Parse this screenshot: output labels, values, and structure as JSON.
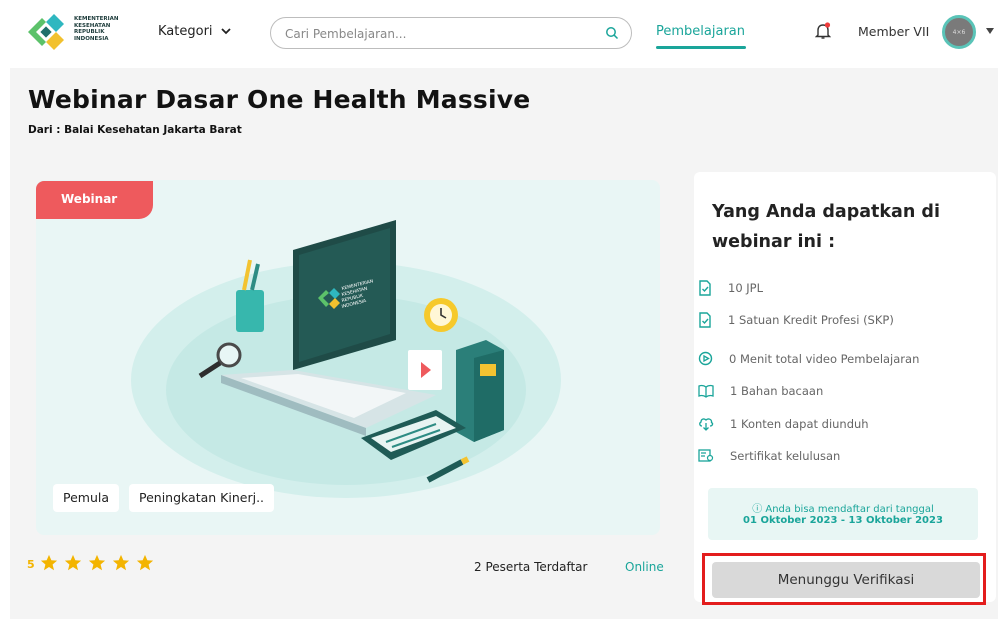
{
  "header": {
    "logo_text": [
      "KEMENTERIAN",
      "KESEHATAN",
      "REPUBLIK",
      "INDONESIA"
    ],
    "kategori_label": "Kategori",
    "search_placeholder": "Cari Pembelajaran...",
    "nav_active": "Pembelajaran",
    "member_name": "Member VII"
  },
  "page": {
    "title": "Webinar Dasar One Health Massive",
    "subtitle": "Dari : Balai Kesehatan Jakarta Barat"
  },
  "banner": {
    "tag": "Webinar",
    "chips": [
      "Pemula",
      "Peningkatan Kinerj.."
    ],
    "laptop_screen_text": [
      "KEMENTERIAN",
      "KESEHATAN",
      "REPUBLIK",
      "INDONESIA"
    ]
  },
  "stats": {
    "rating": "5",
    "stars": 5,
    "participants": "2 Peserta Terdaftar",
    "mode": "Online"
  },
  "sidebar": {
    "title": "Yang Anda dapatkan di webinar ini :",
    "features": [
      {
        "icon": "document-check-icon",
        "text": "10 JPL"
      },
      {
        "icon": "document-check-icon",
        "text": "1 Satuan Kredit Profesi (SKP)"
      },
      {
        "icon": "play-circle-icon",
        "text": "0 Menit total video Pembelajaran"
      },
      {
        "icon": "book-open-icon",
        "text": "1 Bahan bacaan"
      },
      {
        "icon": "cloud-download-icon",
        "text": "1 Konten dapat diunduh"
      },
      {
        "icon": "certificate-icon",
        "text": "Sertifikat kelulusan"
      }
    ],
    "notice_line1": "ⓘ Anda bisa mendaftar dari tanggal",
    "notice_line2": "01 Oktober 2023 - 13 Oktober 2023",
    "button_label": "Menunggu Verifikasi"
  },
  "colors": {
    "accent": "#1aa59a",
    "tag": "#ee5a5d",
    "star": "#f3b400",
    "highlight": "#e31d1d"
  }
}
